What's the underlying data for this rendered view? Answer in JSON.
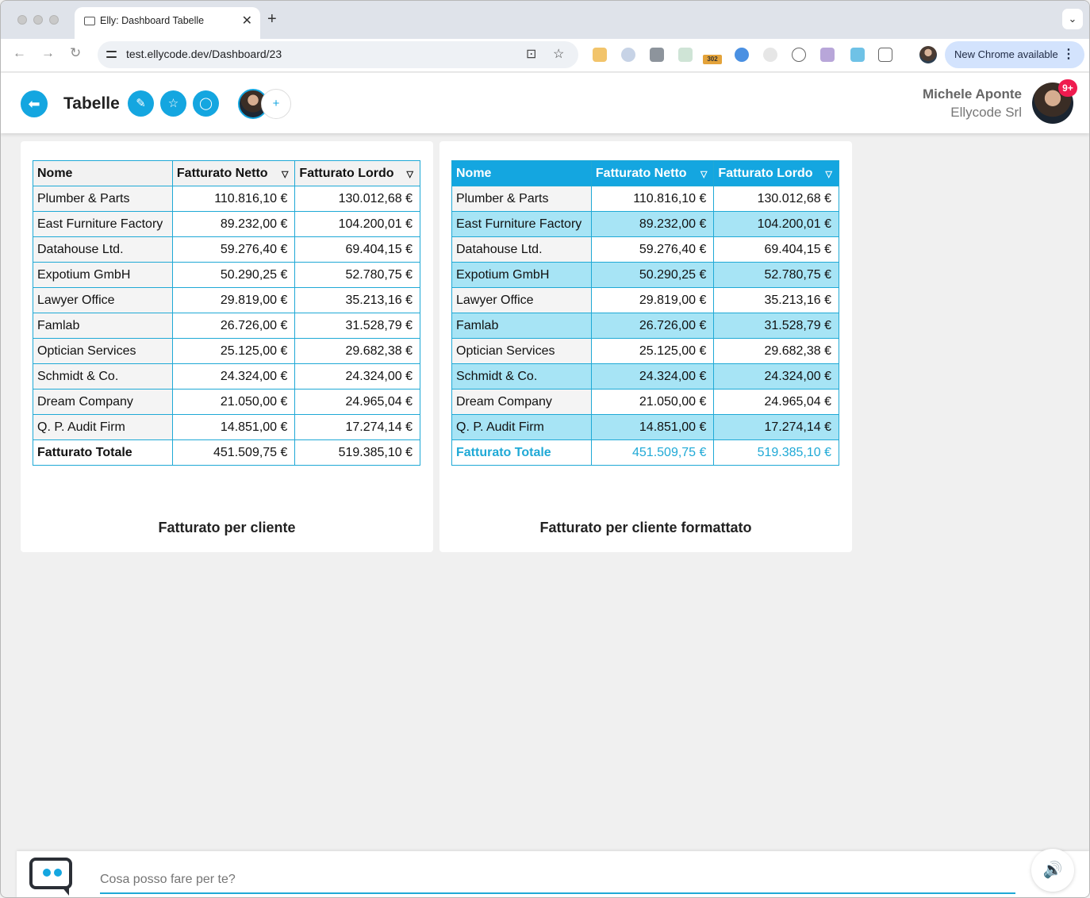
{
  "browser": {
    "tab_title": "Elly: Dashboard Tabelle",
    "tab_close": "✕",
    "new_tab": "+",
    "url": "test.ellycode.dev/Dashboard/23",
    "update_label": "New Chrome available",
    "extension_badge": "302"
  },
  "header": {
    "title": "Tabelle",
    "user_name": "Michele Aponte",
    "company": "Ellycode Srl",
    "notifications": "9+",
    "add_member": "+"
  },
  "tables": [
    {
      "caption": "Fatturato per cliente",
      "columns": [
        "Nome",
        "Fatturato Netto",
        "Fatturato Lordo"
      ],
      "rows": [
        [
          "Plumber & Parts",
          "110.816,10 €",
          "130.012,68 €"
        ],
        [
          "East Furniture Factory",
          "89.232,00 €",
          "104.200,01 €"
        ],
        [
          "Datahouse Ltd.",
          "59.276,40 €",
          "69.404,15 €"
        ],
        [
          "Expotium GmbH",
          "50.290,25 €",
          "52.780,75 €"
        ],
        [
          "Lawyer Office",
          "29.819,00 €",
          "35.213,16 €"
        ],
        [
          "Famlab",
          "26.726,00 €",
          "31.528,79 €"
        ],
        [
          "Optician Services",
          "25.125,00 €",
          "29.682,38 €"
        ],
        [
          "Schmidt & Co.",
          "24.324,00 €",
          "24.324,00 €"
        ],
        [
          "Dream Company",
          "21.050,00 €",
          "24.965,04 €"
        ],
        [
          "Q. P. Audit Firm",
          "14.851,00 €",
          "17.274,14 €"
        ]
      ],
      "total": [
        "Fatturato Totale",
        "451.509,75 €",
        "519.385,10 €"
      ]
    },
    {
      "caption": "Fatturato per cliente formattato",
      "columns": [
        "Nome",
        "Fatturato Netto",
        "Fatturato Lordo"
      ],
      "rows": [
        [
          "Plumber & Parts",
          "110.816,10 €",
          "130.012,68 €"
        ],
        [
          "East Furniture Factory",
          "89.232,00 €",
          "104.200,01 €"
        ],
        [
          "Datahouse Ltd.",
          "59.276,40 €",
          "69.404,15 €"
        ],
        [
          "Expotium GmbH",
          "50.290,25 €",
          "52.780,75 €"
        ],
        [
          "Lawyer Office",
          "29.819,00 €",
          "35.213,16 €"
        ],
        [
          "Famlab",
          "26.726,00 €",
          "31.528,79 €"
        ],
        [
          "Optician Services",
          "25.125,00 €",
          "29.682,38 €"
        ],
        [
          "Schmidt & Co.",
          "24.324,00 €",
          "24.324,00 €"
        ],
        [
          "Dream Company",
          "21.050,00 €",
          "24.965,04 €"
        ],
        [
          "Q. P. Audit Firm",
          "14.851,00 €",
          "17.274,14 €"
        ]
      ],
      "total": [
        "Fatturato Totale",
        "451.509,75 €",
        "519.385,10 €"
      ]
    }
  ],
  "chat": {
    "placeholder": "Cosa posso fare per te?"
  },
  "colors": {
    "accent": "#14a6e0",
    "highlight_row": "#a7e4f5",
    "border": "#1fa9d6",
    "badge": "#ef1b4f"
  }
}
